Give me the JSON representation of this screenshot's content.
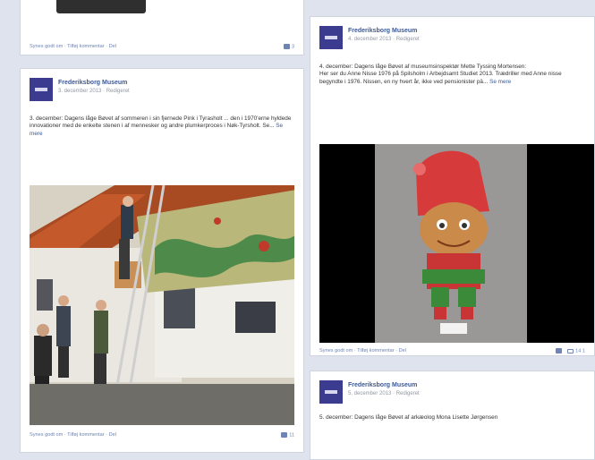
{
  "post_top": {
    "action_text": "Synes godt om · Tilføj kommentar · Del",
    "counts": "3"
  },
  "post_left": {
    "page_name": "Frederiksborg Museum",
    "meta": "3. december 2013 · Redigeret",
    "text": "3. december: Dagens låge Bøvet af sommeren i sin fjernede Pink i Tyrasholt ... den i 1970'erne hyldede innovationer med de enkelte stenen i af mennesker og andre plumkerproces i Nøk-Tyrsholt. Se...",
    "see_more": "Se mere",
    "action_text": "Synes godt om · Tilføj kommentar · Del",
    "counts": "11"
  },
  "post_right": {
    "page_name": "Frederiksborg Museum",
    "meta": "4. december 2013 · Redigeret",
    "text": "4. december: Dagens låge Bøvet af museumsinspektør Mette Tyssing Mortensen:\nHer ser du Anne Nisse 1976 på Spilsholm i Arbejdsamt Studiet 2013. Trædriller med Anne nisse begyndte i 1976. Nissen, en ny hvert år, ikke ved pensionister pä...",
    "see_more": "Se mere",
    "action_text": "Synes godt om · Tilføj kommentar · Del",
    "counts": "14  1"
  },
  "post_bottom_right": {
    "page_name": "Frederiksborg Museum",
    "meta": "5. december 2013 · Redigeret",
    "text": "5. december: Dagens låge Bøvet af arkæolog Mona Lisette Jørgensen"
  }
}
